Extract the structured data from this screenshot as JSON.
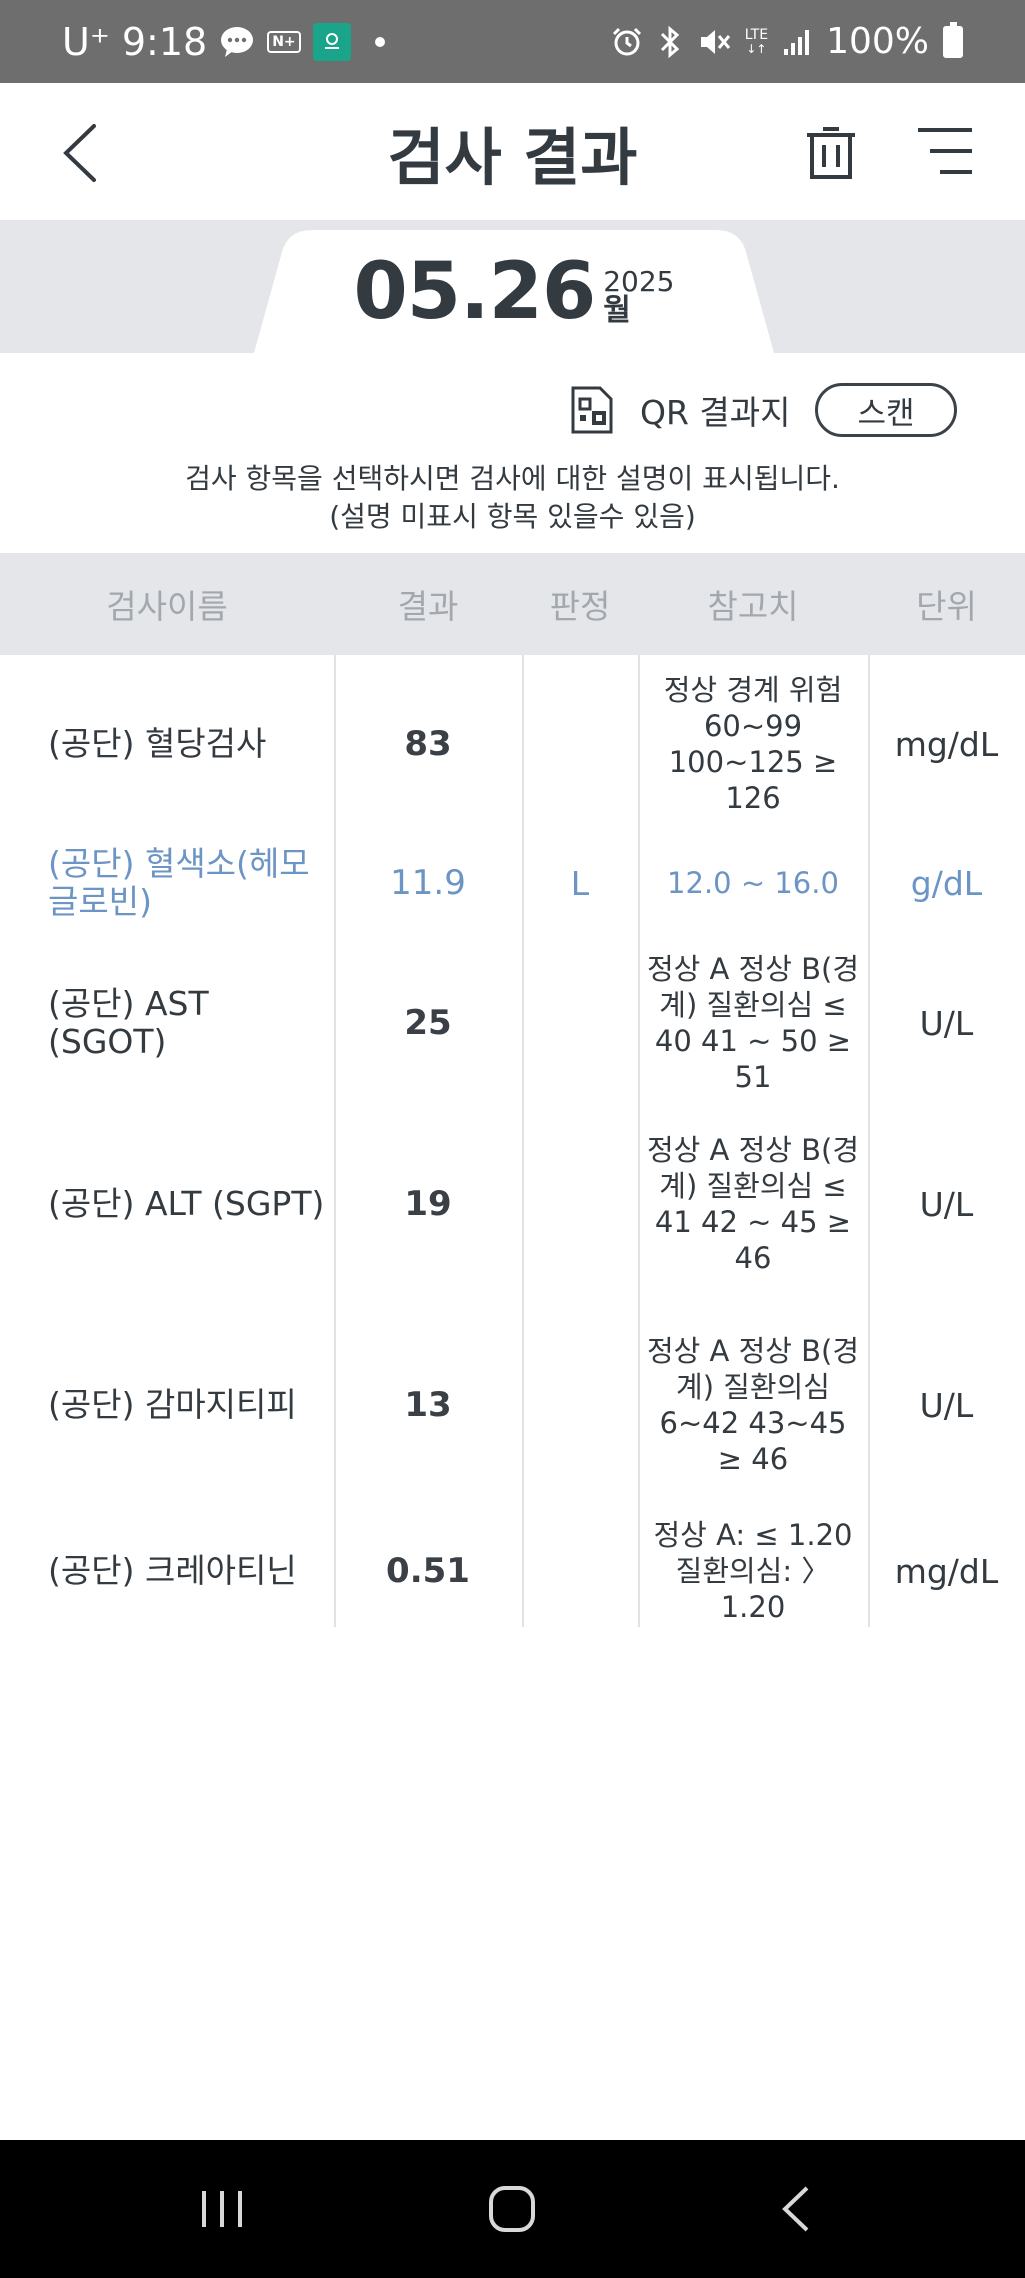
{
  "status_bar": {
    "carrier": "U⁺",
    "time": "9:18",
    "battery": "100%",
    "network": "LTE"
  },
  "header": {
    "title": "검사 결과"
  },
  "date": {
    "main": "05.26",
    "year": "2025",
    "weekday": "월"
  },
  "qr": {
    "label": "QR 결과지",
    "scan_button": "스캔"
  },
  "notice": {
    "line1": "검사 항목을 선택하시면 검사에 대한 설명이 표시됩니다.",
    "line2": "(설명 미표시 항목 있을수 있음)"
  },
  "table": {
    "headers": {
      "name": "검사이름",
      "result": "결과",
      "judgement": "판정",
      "reference": "참고치",
      "unit": "단위"
    },
    "rows": [
      {
        "name": "(공단) 혈당검사",
        "result": "83",
        "judgement": "",
        "reference": "정상 경계 위험 60~99 100~125 ≥ 126",
        "unit": "mg/dL"
      },
      {
        "name": "(공단) 혈색소(헤모글로빈)",
        "result": "11.9",
        "judgement": "L",
        "reference": "12.0 ~ 16.0",
        "unit": "g/dL"
      },
      {
        "name": "(공단) AST (SGOT)",
        "result": "25",
        "judgement": "",
        "reference": "정상 A 정상 B(경계) 질환의심 ≤ 40 41 ~ 50 ≥ 51",
        "unit": "U/L"
      },
      {
        "name": "(공단) ALT (SGPT)",
        "result": "19",
        "judgement": "",
        "reference": "정상 A 정상 B(경계) 질환의심 ≤ 41 42 ~ 45 ≥ 46",
        "unit": "U/L"
      },
      {
        "name": "(공단) 감마지티피",
        "result": "13",
        "judgement": "",
        "reference": "정상 A 정상 B(경계) 질환의심 6~42 43~45 ≥ 46",
        "unit": "U/L"
      },
      {
        "name": "(공단) 크레아티닌",
        "result": "0.51",
        "judgement": "",
        "reference": "정상 A: ≤ 1.20 질환의심: 〉1.20",
        "unit": "mg/dL"
      }
    ]
  },
  "colors": {
    "abnormal_text": "#6c94c4",
    "band_background": "#e5e6ea",
    "status_bar": "#6e6e6e"
  }
}
